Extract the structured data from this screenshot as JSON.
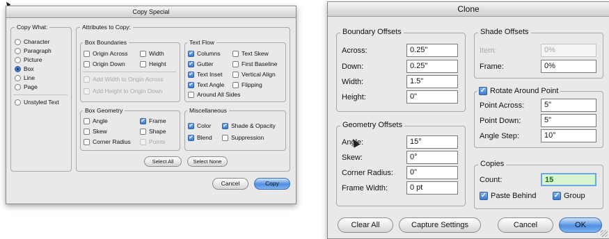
{
  "copy_special": {
    "title": "Copy Special",
    "copy_what": {
      "legend": "Copy What:",
      "options": [
        "Character",
        "Paragraph",
        "Picture",
        "Box",
        "Line",
        "Page"
      ],
      "selected": "Box",
      "extra": "Unstyled Text"
    },
    "attributes": {
      "legend": "Attributes to Copy:",
      "box_boundaries": {
        "legend": "Box Boundaries",
        "origin_across": "Origin Across",
        "width": "Width",
        "origin_down": "Origin Down",
        "height": "Height",
        "add_width": "Add Width to Origin Across",
        "add_height": "Add Height to Origin Down"
      },
      "text_flow": {
        "legend": "Text Flow",
        "columns": "Columns",
        "text_skew": "Text Skew",
        "gutter": "Gutter",
        "first_baseline": "First Baseline",
        "text_inset": "Text Inset",
        "vertical_align": "Vertical Align",
        "text_angle": "Text Angle",
        "flipping": "Flipping",
        "around_all_sides": "Around All Sides"
      },
      "box_geometry": {
        "legend": "Box Geometry",
        "angle": "Angle",
        "frame": "Frame",
        "skew": "Skew",
        "shape": "Shape",
        "corner_radius": "Corner Radius",
        "points": "Points"
      },
      "miscellaneous": {
        "legend": "Miscellaneous",
        "color": "Color",
        "shade_opacity": "Shade & Opacity",
        "blend": "Blend",
        "suppression": "Suppression"
      },
      "select_all": "Select All",
      "select_none": "Select None"
    },
    "cancel": "Cancel",
    "copy": "Copy"
  },
  "clone": {
    "title": "Clone",
    "boundary_offsets": {
      "legend": "Boundary Offsets",
      "across_label": "Across:",
      "across_value": "0.25\"",
      "down_label": "Down:",
      "down_value": "0.25\"",
      "width_label": "Width:",
      "width_value": "1.5\"",
      "height_label": "Height:",
      "height_value": "0\""
    },
    "shade_offsets": {
      "legend": "Shade Offsets",
      "item_label": "Item:",
      "item_value": "0%",
      "frame_label": "Frame:",
      "frame_value": "0%"
    },
    "rotate": {
      "legend": "Rotate Around Point",
      "point_across_label": "Point Across:",
      "point_across_value": "5\"",
      "point_down_label": "Point Down:",
      "point_down_value": "5\"",
      "angle_step_label": "Angle Step:",
      "angle_step_value": "10°"
    },
    "geometry_offsets": {
      "legend": "Geometry Offsets",
      "angle_label": "Angle:",
      "angle_value": "15°",
      "skew_label": "Skew:",
      "skew_value": "0°",
      "corner_radius_label": "Corner Radius:",
      "corner_radius_value": "0\"",
      "frame_width_label": "Frame Width:",
      "frame_width_value": "0 pt"
    },
    "copies": {
      "legend": "Copies",
      "count_label": "Count:",
      "count_value": "15",
      "paste_behind": "Paste Behind",
      "group": "Group"
    },
    "clear_all": "Clear All",
    "capture_settings": "Capture Settings",
    "cancel": "Cancel",
    "ok": "OK"
  },
  "colors": {
    "accent": "#3a7bd5",
    "dialog_bg": "#e9e9e9",
    "count_highlight": "#d6f5d0"
  }
}
